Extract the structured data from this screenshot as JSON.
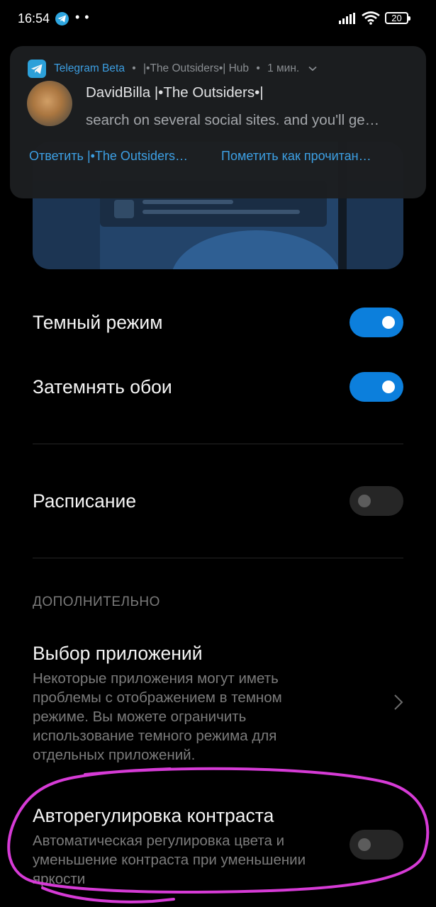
{
  "status_bar": {
    "time": "16:54",
    "notification_icons": "• •",
    "battery": "20",
    "icons": [
      "telegram-icon",
      "signal-icon",
      "wifi-icon",
      "battery-icon"
    ]
  },
  "notification": {
    "app_name": "Telegram Beta",
    "separator": "•",
    "group": "|•The Outsiders•| Hub",
    "time": "1 мин.",
    "title": "DavidBilla |•The Outsiders•|",
    "body": "search on several social sites. and you'll ge…",
    "actions": [
      {
        "label": "Ответить |•The Outsiders…"
      },
      {
        "label": "Пометить как прочитан…"
      }
    ],
    "accent_color": "#3ea3e8"
  },
  "settings": {
    "dark_mode": {
      "label": "Темный режим",
      "enabled": true
    },
    "dim_wallpaper": {
      "label": "Затемнять обои",
      "enabled": true
    },
    "schedule": {
      "label": "Расписание",
      "enabled": false
    },
    "section_additional": "ДОПОЛНИТЕЛЬНО",
    "app_selection": {
      "title": "Выбор приложений",
      "description": "Некоторые приложения могут иметь проблемы с отображением в темном режиме. Вы можете ограничить использование темного режима для отдельных приложений."
    },
    "auto_contrast": {
      "title": "Авторегулировка контраста",
      "description": "Автоматическая регулировка цвета и уменьшение контраста при уменьшении яркости",
      "enabled": false
    },
    "toggle_on_color": "#0c7fdc",
    "annotation_color": "#d63bd6"
  }
}
